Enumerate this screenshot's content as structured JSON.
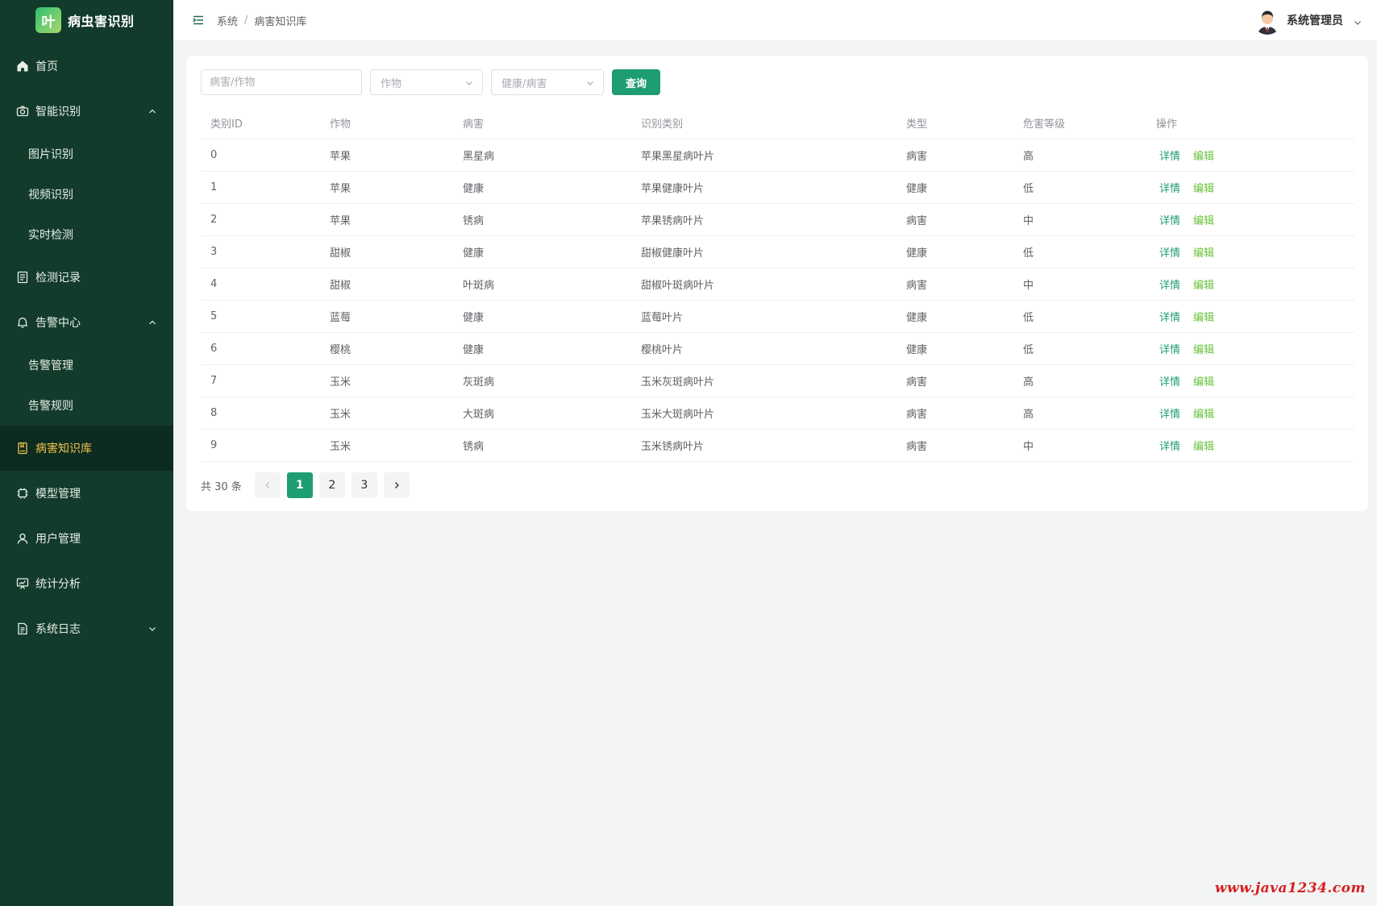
{
  "app": {
    "logo_char": "叶",
    "title": "病虫害识别"
  },
  "sidebar": {
    "items": [
      {
        "label": "首页",
        "icon": "home-icon"
      },
      {
        "label": "智能识别",
        "icon": "camera-icon",
        "expanded": true
      },
      {
        "label": "图片识别"
      },
      {
        "label": "视频识别"
      },
      {
        "label": "实时检测"
      },
      {
        "label": "检测记录",
        "icon": "document-icon"
      },
      {
        "label": "告警中心",
        "icon": "bell-icon",
        "expanded": true
      },
      {
        "label": "告警管理"
      },
      {
        "label": "告警规则"
      },
      {
        "label": "病害知识库",
        "icon": "book-icon",
        "active": true
      },
      {
        "label": "模型管理",
        "icon": "chip-icon"
      },
      {
        "label": "用户管理",
        "icon": "user-icon"
      },
      {
        "label": "统计分析",
        "icon": "chart-icon"
      },
      {
        "label": "系统日志",
        "icon": "log-icon",
        "expanded": false
      }
    ]
  },
  "header": {
    "breadcrumb": [
      "系统",
      "病害知识库"
    ],
    "breadcrumb_sep": "/",
    "user_name": "系统管理员"
  },
  "filters": {
    "keyword_placeholder": "病害/作物",
    "crop_placeholder": "作物",
    "status_placeholder": "健康/病害",
    "query_label": "查询"
  },
  "table": {
    "columns": [
      "类别ID",
      "作物",
      "病害",
      "识别类别",
      "类型",
      "危害等级",
      "操作"
    ],
    "detail_label": "详情",
    "edit_label": "编辑",
    "rows": [
      [
        "0",
        "苹果",
        "黑星病",
        "苹果黑星病叶片",
        "病害",
        "高"
      ],
      [
        "1",
        "苹果",
        "健康",
        "苹果健康叶片",
        "健康",
        "低"
      ],
      [
        "2",
        "苹果",
        "锈病",
        "苹果锈病叶片",
        "病害",
        "中"
      ],
      [
        "3",
        "甜椒",
        "健康",
        "甜椒健康叶片",
        "健康",
        "低"
      ],
      [
        "4",
        "甜椒",
        "叶斑病",
        "甜椒叶斑病叶片",
        "病害",
        "中"
      ],
      [
        "5",
        "蓝莓",
        "健康",
        "蓝莓叶片",
        "健康",
        "低"
      ],
      [
        "6",
        "樱桃",
        "健康",
        "樱桃叶片",
        "健康",
        "低"
      ],
      [
        "7",
        "玉米",
        "灰斑病",
        "玉米灰斑病叶片",
        "病害",
        "高"
      ],
      [
        "8",
        "玉米",
        "大斑病",
        "玉米大斑病叶片",
        "病害",
        "高"
      ],
      [
        "9",
        "玉米",
        "锈病",
        "玉米锈病叶片",
        "病害",
        "中"
      ]
    ]
  },
  "pagination": {
    "total_text": "共 30 条",
    "pages": [
      "1",
      "2",
      "3"
    ],
    "current": "1"
  },
  "watermark": "www.java1234.com",
  "colors": {
    "sidebar_bg": "#123b2c",
    "sidebar_active_bg": "#0d2c20",
    "active_text": "#f0c24b",
    "primary": "#1f9d72",
    "edit_link": "#67c23a",
    "watermark": "#d71f1f"
  }
}
